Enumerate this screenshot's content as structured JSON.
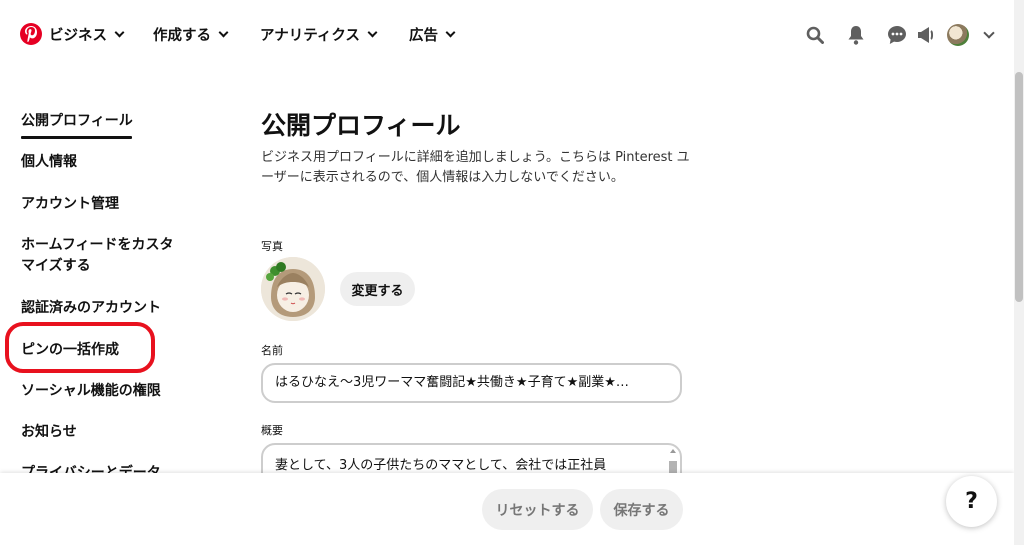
{
  "header": {
    "business_label": "ビジネス",
    "create_label": "作成する",
    "analytics_label": "アナリティクス",
    "ads_label": "広告"
  },
  "sidebar": {
    "items": [
      {
        "label": "公開プロフィール"
      },
      {
        "label": "個人情報"
      },
      {
        "label": "アカウント管理"
      },
      {
        "label": "ホームフィードをカスタマイズする"
      },
      {
        "label": "認証済みのアカウント"
      },
      {
        "label": "ピンの一括作成"
      },
      {
        "label": "ソーシャル機能の権限"
      },
      {
        "label": "お知らせ"
      },
      {
        "label": "プライバシーとデータ"
      }
    ]
  },
  "main": {
    "title": "公開プロフィール",
    "description": "ビジネス用プロフィールに詳細を追加しましょう。こちらは Pinterest ユーザーに表示されるので、個人情報は入力しないでください。",
    "photo_label": "写真",
    "change_button": "変更する",
    "name_label": "名前",
    "name_value": "はるひなえ〜3児ワーママ奮闘記★共働き★子育て★副業★…",
    "about_label": "概要",
    "about_value": "妻として、3人の子供たちのママとして、会社では正社員"
  },
  "footer": {
    "reset_button": "リセットする",
    "save_button": "保存する",
    "help_button": "?"
  },
  "colors": {
    "brand": "#e60023",
    "highlight": "#e8111e"
  }
}
